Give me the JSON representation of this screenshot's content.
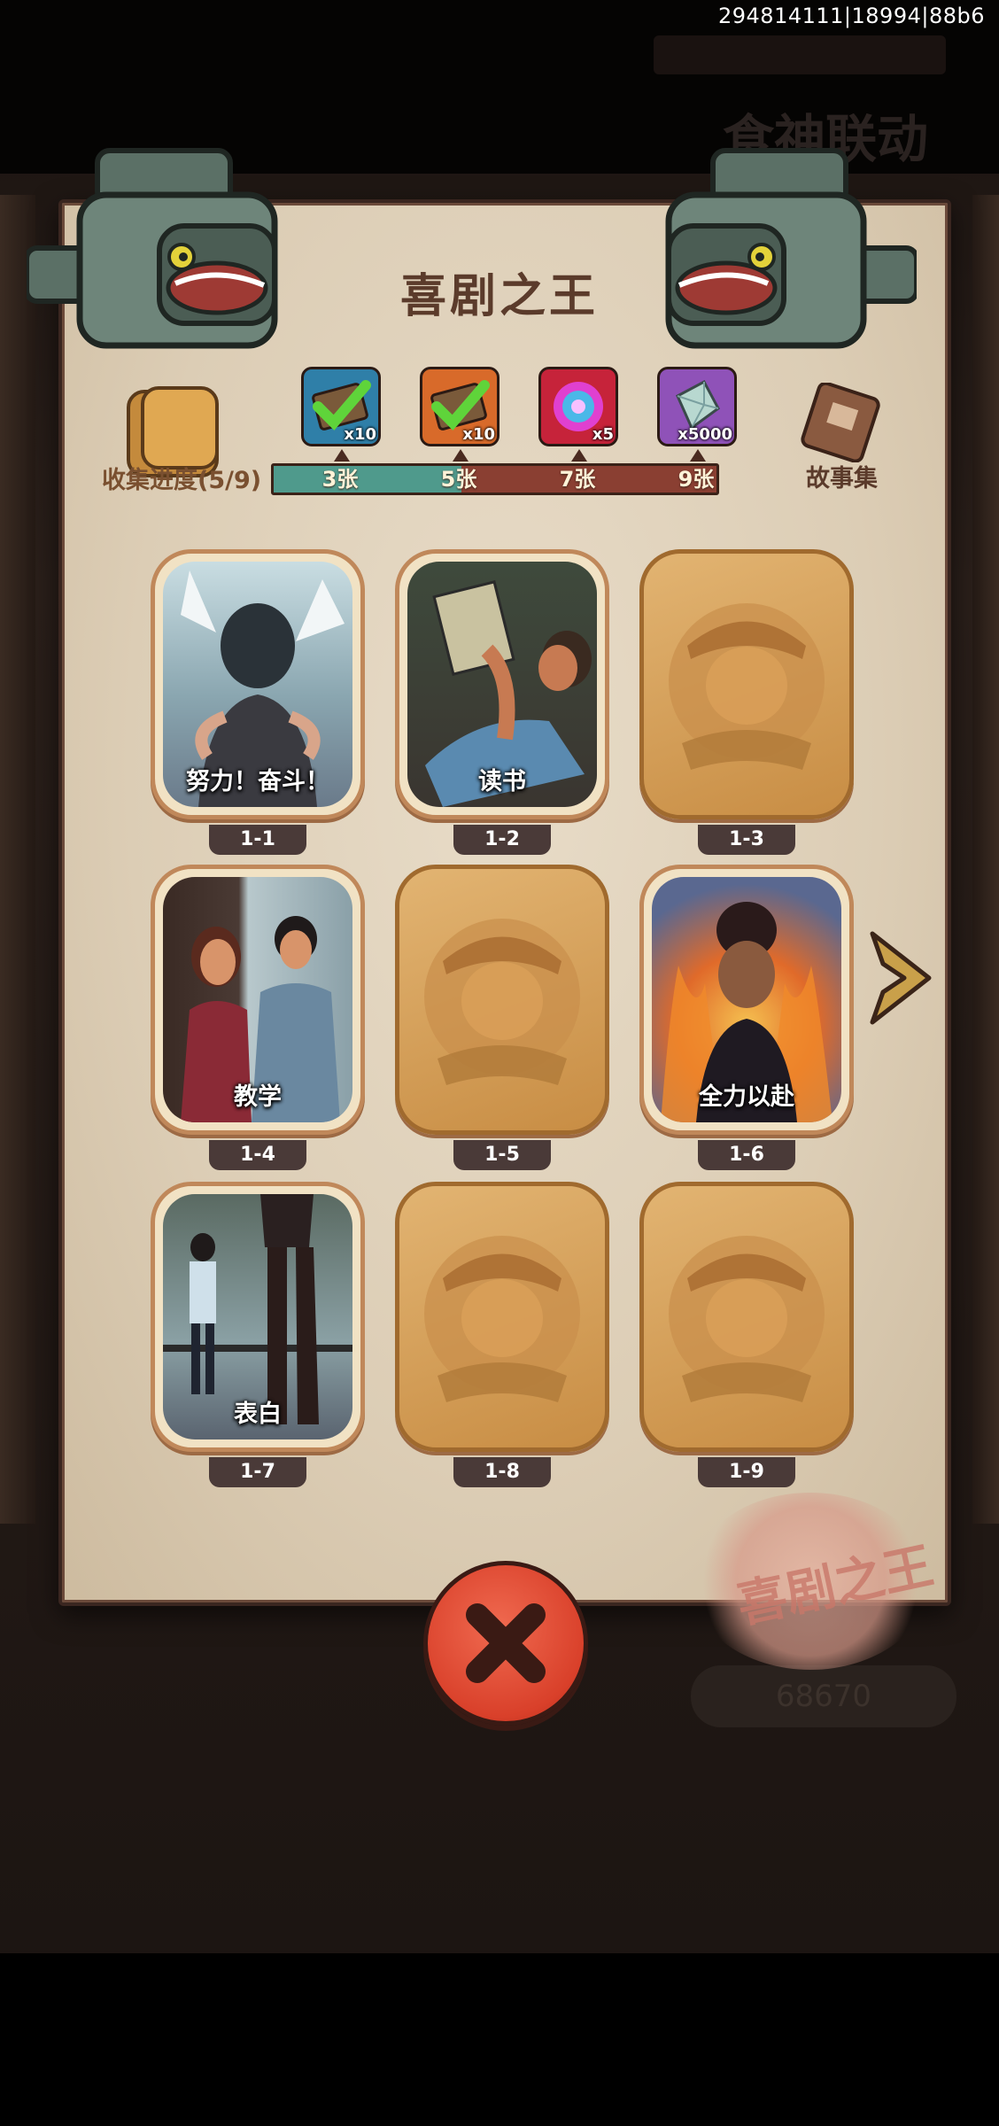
{
  "debug_id": "294814111|18994|88b6",
  "background": {
    "banner_text": "",
    "title_text": "食神联动",
    "counter": "68670"
  },
  "album": {
    "title": "喜剧之王",
    "progress_label": "收集进度(5/9)",
    "collected": 5,
    "total": 9,
    "rewards": [
      {
        "icon": "green-card-check-icon",
        "qty": "x10",
        "threshold": "3张",
        "color": "#2f7fa8"
      },
      {
        "icon": "orange-card-check-icon",
        "qty": "x10",
        "threshold": "5张",
        "color": "#d86a2a"
      },
      {
        "icon": "pink-orb-icon",
        "qty": "x5",
        "threshold": "7张",
        "color": "#c6233a"
      },
      {
        "icon": "purple-gem-icon",
        "qty": "x5000",
        "threshold": "9张",
        "color": "#8f52b8"
      }
    ],
    "story_label": "故事集"
  },
  "cards": [
    {
      "id": "1-1",
      "title": "努力！奋斗！",
      "collected": true,
      "art": "man-back-view"
    },
    {
      "id": "1-2",
      "title": "读书",
      "collected": true,
      "art": "reading-man"
    },
    {
      "id": "1-3",
      "title": "",
      "collected": false,
      "art": "locked-portrait"
    },
    {
      "id": "1-4",
      "title": "教学",
      "collected": true,
      "art": "couple-door"
    },
    {
      "id": "1-5",
      "title": "",
      "collected": false,
      "art": "locked-portrait"
    },
    {
      "id": "1-6",
      "title": "全力以赴",
      "collected": true,
      "art": "fire-woman"
    },
    {
      "id": "1-7",
      "title": "表白",
      "collected": true,
      "art": "boots-balcony"
    },
    {
      "id": "1-8",
      "title": "",
      "collected": false,
      "art": "locked-portrait"
    },
    {
      "id": "1-9",
      "title": "",
      "collected": false,
      "art": "locked-portrait"
    }
  ],
  "colors": {
    "paper": "#dccdb5",
    "title_text": "#5b3b2b",
    "bar_fill": "#4f9a8c",
    "bar_empty": "#8a3f32",
    "locked_card": "#d09a55",
    "close_button": "#d9402a"
  }
}
